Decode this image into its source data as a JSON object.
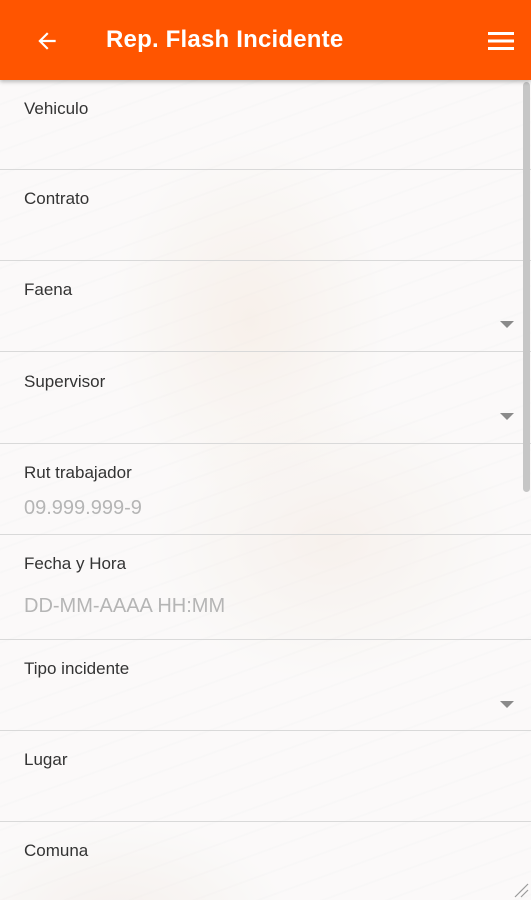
{
  "app_bar": {
    "title": "Rep. Flash Incidente",
    "back_icon": "arrow-left-icon",
    "menu_icon": "hamburger-menu-icon",
    "color": "#ff5500"
  },
  "form": {
    "fields": [
      {
        "label": "Vehiculo",
        "placeholder": "",
        "type": "text"
      },
      {
        "label": "Contrato",
        "placeholder": "",
        "type": "text"
      },
      {
        "label": "Faena",
        "placeholder": "",
        "type": "select"
      },
      {
        "label": "Supervisor",
        "placeholder": "",
        "type": "select"
      },
      {
        "label": "Rut trabajador",
        "placeholder": "09.999.999-9",
        "type": "text"
      },
      {
        "label": "Fecha y Hora",
        "placeholder": "DD-MM-AAAA HH:MM",
        "type": "text"
      },
      {
        "label": "Tipo incidente",
        "placeholder": "",
        "type": "select"
      },
      {
        "label": "Lugar",
        "placeholder": "",
        "type": "text"
      },
      {
        "label": "Comuna",
        "placeholder": "",
        "type": "text"
      }
    ]
  }
}
